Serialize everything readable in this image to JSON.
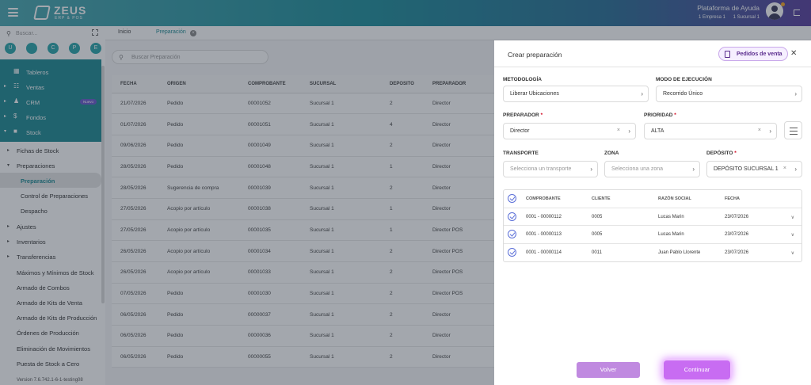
{
  "header": {
    "logo_name": "ZEUS",
    "logo_sub": "ERP & POS",
    "help_link": "Plataforma de Ayuda",
    "company": "1 Empresa 1",
    "branch": "1 Sucursal 1"
  },
  "sidebar": {
    "search_placeholder": "Buscar...",
    "quick": [
      "U",
      "",
      "C",
      "P",
      "E"
    ],
    "main_items": [
      {
        "label": "Tableros"
      },
      {
        "label": "Ventas"
      },
      {
        "label": "CRM",
        "badge": "Nuevo"
      },
      {
        "label": "Fondos"
      },
      {
        "label": "Stock"
      }
    ],
    "stock_items": [
      {
        "label": "Fichas de Stock"
      },
      {
        "label": "Preparaciones"
      },
      {
        "label": "Preparación"
      },
      {
        "label": "Control de Preparaciones"
      },
      {
        "label": "Despacho"
      },
      {
        "label": "Ajustes"
      },
      {
        "label": "Inventarios"
      },
      {
        "label": "Transferencias"
      },
      {
        "label": "Máximos y Mínimos de Stock"
      },
      {
        "label": "Armado de Combos"
      },
      {
        "label": "Armado de Kits de Venta"
      },
      {
        "label": "Armado de Kits de Producción"
      },
      {
        "label": "Órdenes de Producción"
      },
      {
        "label": "Eliminación de Movimientos"
      },
      {
        "label": "Puesta de Stock a Cero"
      }
    ],
    "version": "Version 7.6.742.1-6-1-testing08"
  },
  "tabs": [
    {
      "label": "Inicio"
    },
    {
      "label": "Preparación"
    }
  ],
  "list": {
    "search_placeholder": "Buscar Preparación",
    "columns": [
      "FECHA",
      "ORIGEN",
      "COMPROBANTE",
      "SUCURSAL",
      "DEPOSITO",
      "PREPARADOR"
    ],
    "rows": [
      [
        "21/07/2026",
        "Pedido",
        "00001052",
        "Sucursal 1",
        "2",
        "Director"
      ],
      [
        "01/07/2026",
        "Pedido",
        "00001051",
        "Sucursal 1",
        "4",
        "Director"
      ],
      [
        "09/06/2026",
        "Pedido",
        "00001049",
        "Sucursal 1",
        "2",
        "Director"
      ],
      [
        "28/05/2026",
        "Pedido",
        "00001048",
        "Sucursal 1",
        "1",
        "Director"
      ],
      [
        "28/05/2026",
        "Sugerencia de compra",
        "00001039",
        "Sucursal 1",
        "2",
        "Director"
      ],
      [
        "27/05/2026",
        "Acopio por artículo",
        "00001038",
        "Sucursal 1",
        "1",
        "Director"
      ],
      [
        "27/05/2026",
        "Acopio por artículo",
        "00001035",
        "Sucursal 1",
        "1",
        "Director POS"
      ],
      [
        "26/05/2026",
        "Acopio por artículo",
        "00001034",
        "Sucursal 1",
        "2",
        "Director POS"
      ],
      [
        "26/05/2026",
        "Acopio por artículo",
        "00001033",
        "Sucursal 1",
        "2",
        "Director POS"
      ],
      [
        "07/05/2026",
        "Pedido",
        "00001030",
        "Sucursal 1",
        "2",
        "Director POS"
      ],
      [
        "06/05/2026",
        "Pedido",
        "00000037",
        "Sucursal 1",
        "2",
        "Director"
      ],
      [
        "06/05/2026",
        "Pedido",
        "00000036",
        "Sucursal 1",
        "2",
        "Director"
      ],
      [
        "06/05/2026",
        "Pedido",
        "00000055",
        "Sucursal 1",
        "2",
        "Director"
      ]
    ]
  },
  "panel": {
    "title": "Crear preparación",
    "sales_orders_button": "Pedidos de venta",
    "fields": {
      "metodologia": {
        "label": "METODOLOGÍA",
        "value": "Liberar Ubicaciones"
      },
      "modo": {
        "label": "MODO DE EJECUCIÓN",
        "value": "Recorrido Único"
      },
      "preparador": {
        "label": "PREPARADOR",
        "value": "Director"
      },
      "prioridad": {
        "label": "PRIORIDAD",
        "value": "ALTA"
      },
      "transporte": {
        "label": "TRANSPORTE",
        "placeholder": "Selecciona un transporte"
      },
      "zona": {
        "label": "ZONA",
        "placeholder": "Selecciona una zona"
      },
      "deposito": {
        "label": "DEPÓSITO",
        "value": "DEPÓSITO SUCURSAL 1"
      }
    },
    "required_mark": "*",
    "docs_columns": [
      "COMPROBANTE",
      "CLIENTE",
      "RAZÓN SOCIAL",
      "FECHA"
    ],
    "docs_rows": [
      [
        "0001 - 00000112",
        "0005",
        "Lucas Marin",
        "23/07/2026"
      ],
      [
        "0001 - 00000113",
        "0005",
        "Lucas Marin",
        "23/07/2026"
      ],
      [
        "0001 - 00000114",
        "0011",
        "Juan Pablo Llorente",
        "23/07/2026"
      ]
    ],
    "back_button": "Volver",
    "continue_button": "Continuar"
  }
}
